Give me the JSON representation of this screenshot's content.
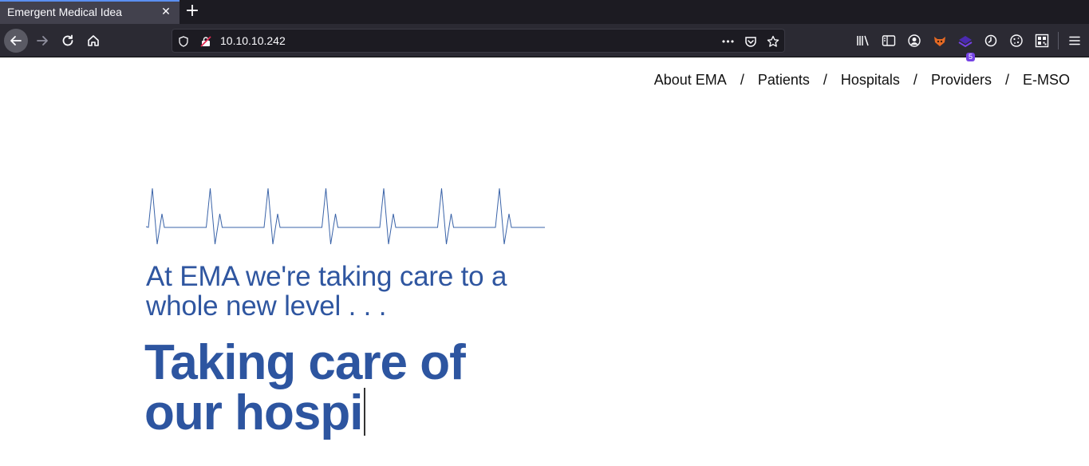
{
  "browser": {
    "tab_title": "Emergent Medical Idea",
    "tab_close": "✕",
    "new_tab": "+",
    "url": "10.10.10.242",
    "url_more": "•••",
    "extension_badge": "5"
  },
  "page": {
    "nav": {
      "items": [
        "About EMA",
        "Patients",
        "Hospitals",
        "Providers",
        "E-MSO"
      ],
      "separator": "/"
    },
    "tagline": "At EMA we're taking care to a whole new level . . .",
    "headline_line1": "Taking care of",
    "headline_line2": "our hospi"
  },
  "colors": {
    "brand_blue": "#2d55a0",
    "ecg_line": "#3a63a8"
  }
}
